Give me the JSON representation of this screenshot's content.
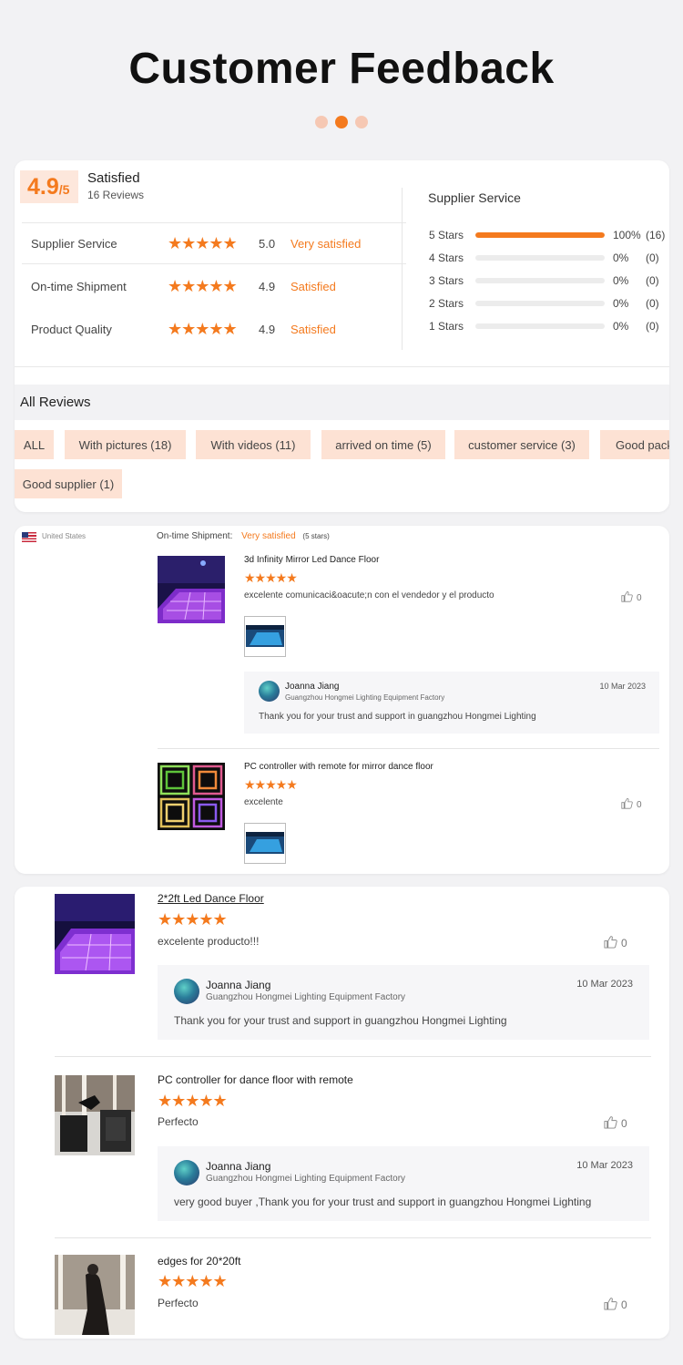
{
  "header": {
    "title": "Customer Feedback"
  },
  "colors": {
    "accent": "#f47a1e",
    "chip_bg": "#fde2d4",
    "page_bg": "#f2f2f4"
  },
  "summary": {
    "score": "4.9",
    "score_suffix": "/5",
    "label": "Satisfied",
    "review_count": "16 Reviews",
    "metrics": [
      {
        "label": "Supplier Service",
        "stars": "★★★★★",
        "value": "5.0",
        "rating": "Very satisfied"
      },
      {
        "label": "On-time Shipment",
        "stars": "★★★★★",
        "value": "4.9",
        "rating": "Satisfied"
      },
      {
        "label": "Product Quality",
        "stars": "★★★★★",
        "value": "4.9",
        "rating": "Satisfied"
      }
    ],
    "breakdown_title": "Supplier Service",
    "breakdown": [
      {
        "label": "5 Stars",
        "fraction": 1.0,
        "percent": "100%",
        "count": "(16)"
      },
      {
        "label": "4 Stars",
        "fraction": 0,
        "percent": "0%",
        "count": "(0)"
      },
      {
        "label": "3 Stars",
        "fraction": 0,
        "percent": "0%",
        "count": "(0)"
      },
      {
        "label": "2 Stars",
        "fraction": 0,
        "percent": "0%",
        "count": "(0)"
      },
      {
        "label": "1 Stars",
        "fraction": 0,
        "percent": "0%",
        "count": "(0)"
      }
    ]
  },
  "all_reviews": {
    "title": "All Reviews",
    "filters": [
      "ALL",
      "With pictures (18)",
      "With videos (11)",
      "arrived on time (5)",
      "customer service (3)",
      "Good pack",
      "Good supplier (1)"
    ]
  },
  "review_card_1": {
    "country": "United States",
    "shipment_label": "On-time Shipment:",
    "shipment_rating": "Very satisfied",
    "shipment_stars": "(5 stars)",
    "reviews": [
      {
        "title": "3d Infinity Mirror Led Dance Floor",
        "stars": "★★★★★",
        "text": "excelente comunicaci&oacute;n con el vendedor y el producto",
        "likes": "0",
        "reply": {
          "name": "Joanna Jiang",
          "company": "Guangzhou Hongmei Lighting Equipment Factory",
          "date": "10 Mar 2023",
          "text": "Thank you for your trust and support in guangzhou Hongmei Lighting"
        }
      },
      {
        "title": "PC controller with remote for mirror dance floor",
        "stars": "★★★★★",
        "text": "excelente",
        "likes": "0"
      }
    ]
  },
  "review_card_2": {
    "reviews": [
      {
        "title": "2*2ft Led Dance Floor",
        "stars": "★★★★★",
        "text": "excelente producto!!!",
        "likes": "0",
        "reply": {
          "name": "Joanna Jiang",
          "company": "Guangzhou Hongmei Lighting Equipment Factory",
          "date": "10 Mar 2023",
          "text": "Thank you for your trust and support in guangzhou Hongmei Lighting"
        }
      },
      {
        "title": "PC controller for dance floor with remote",
        "stars": "★★★★★",
        "text": "Perfecto",
        "likes": "0",
        "reply": {
          "name": "Joanna Jiang",
          "company": "Guangzhou Hongmei Lighting Equipment Factory",
          "date": "10 Mar 2023",
          "text": "very good buyer ,Thank you for your trust and support in guangzhou Hongmei Lighting"
        }
      },
      {
        "title": "edges for 20*20ft",
        "stars": "★★★★★",
        "text": "Perfecto",
        "likes": "0"
      }
    ]
  }
}
